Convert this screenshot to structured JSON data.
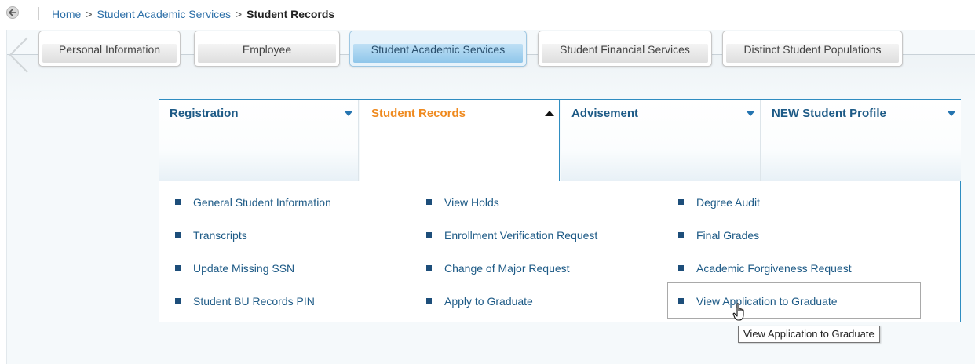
{
  "breadcrumb": {
    "home": "Home",
    "level1": "Student Academic Services",
    "current": "Student Records",
    "separator": ">"
  },
  "tabs": [
    {
      "label": "Personal Information",
      "active": false
    },
    {
      "label": "Employee",
      "active": false
    },
    {
      "label": "Student Academic Services",
      "active": true
    },
    {
      "label": "Student Financial Services",
      "active": false
    },
    {
      "label": "Distinct Student Populations",
      "active": false
    }
  ],
  "menu": {
    "headers": [
      {
        "label": "Registration",
        "open": false
      },
      {
        "label": "Student Records",
        "open": true
      },
      {
        "label": "Advisement",
        "open": false
      },
      {
        "label": "NEW Student Profile",
        "open": false
      }
    ],
    "columns": [
      [
        "General Student Information",
        "Transcripts",
        "Update Missing SSN",
        "Student BU Records PIN"
      ],
      [
        "View Holds",
        "Enrollment Verification Request",
        "Change of Major Request",
        "Apply to Graduate"
      ],
      [
        "Degree Audit",
        "Final Grades",
        "Academic Forgiveness Request",
        "View Application to Graduate"
      ]
    ]
  },
  "tooltip": "View Application to Graduate",
  "colors": {
    "link": "#1d5a86",
    "active_header": "#ef8a1f",
    "accent_border": "#2f8dc1"
  },
  "icons": [
    "back-arrow-icon",
    "dropdown-arrow-icon",
    "bullet-icon",
    "hand-pointer-icon"
  ]
}
